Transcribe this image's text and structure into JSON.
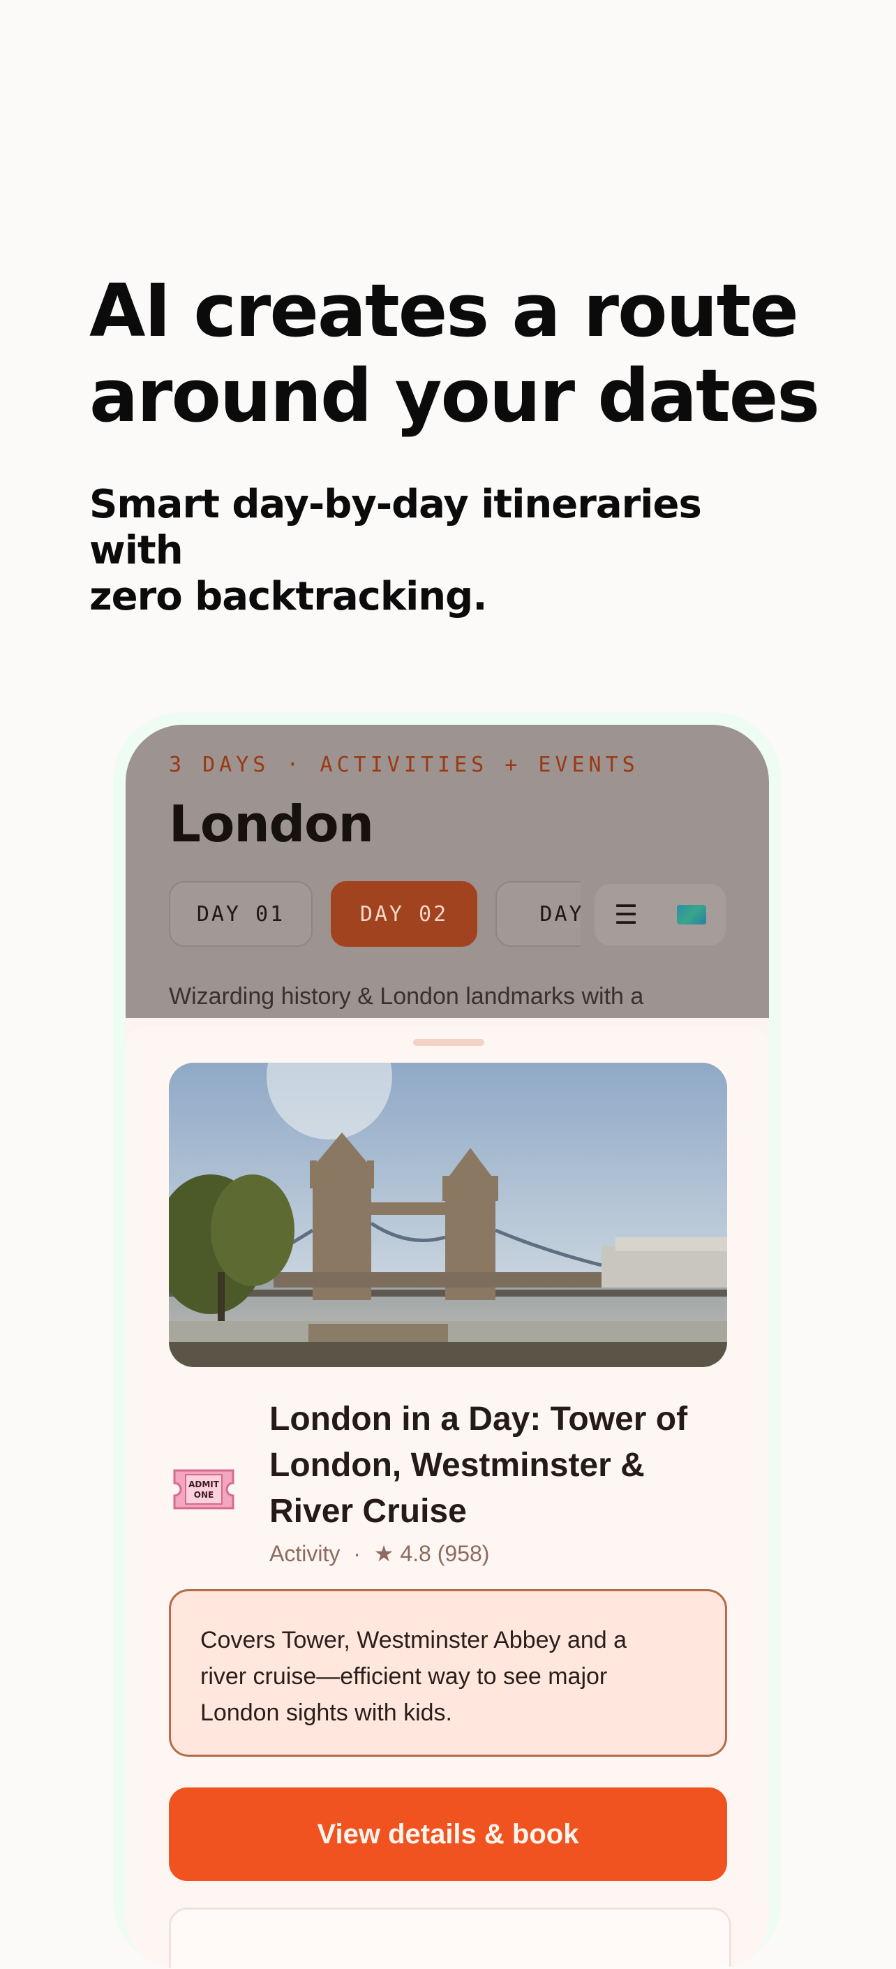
{
  "promo": {
    "headline_line1": "AI creates a route",
    "headline_line2": "around your dates",
    "subhead_line1": "Smart day-by-day itineraries with",
    "subhead_line2": "zero backtracking."
  },
  "trip": {
    "meta": "3 DAYS · ACTIVITIES + EVENTS",
    "city": "London",
    "days": [
      {
        "label": "DAY 01",
        "active": false
      },
      {
        "label": "DAY 02",
        "active": true
      },
      {
        "label": "DAY",
        "active": false
      }
    ],
    "view_toggle": {
      "list_icon": "list-icon",
      "map_icon": "world-map-icon"
    },
    "day_description": "Wizarding history & London landmarks with a"
  },
  "activity": {
    "photo_icon": "tower-bridge-photo",
    "type_icon": "admit-one-ticket-icon",
    "ticket_text_line1": "ADMIT",
    "ticket_text_line2": "ONE",
    "title_line1": "London in a Day: Tower of",
    "title_line2": "London, Westminster &",
    "title_line3": "River Cruise",
    "category": "Activity",
    "separator": "·",
    "rating": "★ 4.8 (958)",
    "note_line1": "Covers Tower, Westminster Abbey and a",
    "note_line2": "river cruise—efficient way to see major",
    "note_line3": "London sights with kids.",
    "cta_label": "View details & book"
  },
  "colors": {
    "accent": "#f0531f",
    "active_tab": "#a2431f",
    "note_bg": "#ffe7de",
    "note_border": "#b36b4c"
  }
}
